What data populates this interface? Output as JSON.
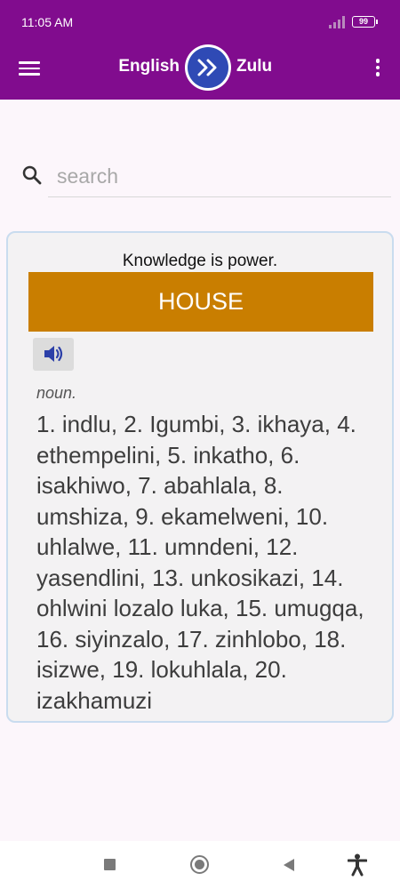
{
  "status_bar": {
    "time": "11:05 AM",
    "battery": "99"
  },
  "app_bar": {
    "lang_from": "English",
    "lang_to": "Zulu"
  },
  "search": {
    "placeholder": "search",
    "value": ""
  },
  "card": {
    "quote": "Knowledge is power.",
    "word": "HOUSE",
    "part_of_speech": "noun.",
    "translations": "1. indlu, 2. Igumbi, 3. ikhaya, 4. ethempelini, 5. inkatho, 6. isakhiwo, 7. abahlala, 8. umshiza, 9. ekamelweni, 10. uhlalwe, 11. umndeni, 12. yasendlini, 13. unkosikazi, 14. ohlwini lozalo luka, 15. umugqa, 16. siyinzalo, 17. zinhlobo, 18. isizwe, 19. lokuhlala, 20. izakhamuzi"
  },
  "colors": {
    "app_bar": "#810c8e",
    "swap_button": "#2f4ab5",
    "word_banner": "#c97e00",
    "background": "#fcf6fb"
  },
  "icons": [
    "signal-icon",
    "battery-icon",
    "menu-icon",
    "swap-arrows-icon",
    "more-vert-icon",
    "search-icon",
    "speaker-icon",
    "nav-recents-icon",
    "nav-home-icon",
    "nav-back-icon",
    "accessibility-icon"
  ]
}
